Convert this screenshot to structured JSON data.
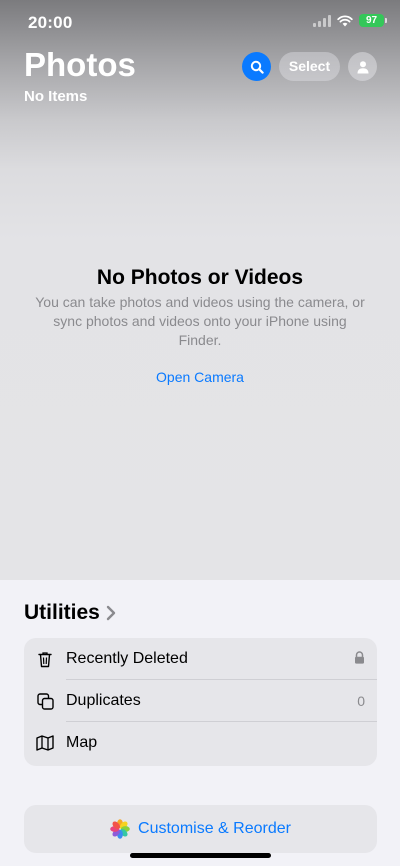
{
  "status_bar": {
    "time": "20:00",
    "battery": "97",
    "signal_icon": "cellular-signal-icon",
    "wifi_icon": "wifi-icon"
  },
  "header": {
    "title": "Photos",
    "subtitle": "No Items",
    "search_icon": "search-icon",
    "select_label": "Select",
    "profile_icon": "person-icon"
  },
  "empty_state": {
    "title": "No Photos or Videos",
    "body": "You can take photos and videos using the camera, or sync photos and videos onto your iPhone using Finder.",
    "action_label": "Open Camera"
  },
  "utilities": {
    "title": "Utilities",
    "chevron_icon": "chevron-right-icon",
    "items": [
      {
        "label": "Recently Deleted",
        "icon": "trash-icon",
        "trailing_icon": "lock-icon"
      },
      {
        "label": "Duplicates",
        "icon": "duplicate-icon",
        "count": "0"
      },
      {
        "label": "Map",
        "icon": "map-icon"
      }
    ]
  },
  "customise": {
    "label": "Customise & Reorder",
    "icon": "photos-flower-icon"
  },
  "colors": {
    "accent": "#0a7aff",
    "battery": "#34c759",
    "secondary_text": "#8a8a8e",
    "card_background": "#e6e6ea"
  }
}
